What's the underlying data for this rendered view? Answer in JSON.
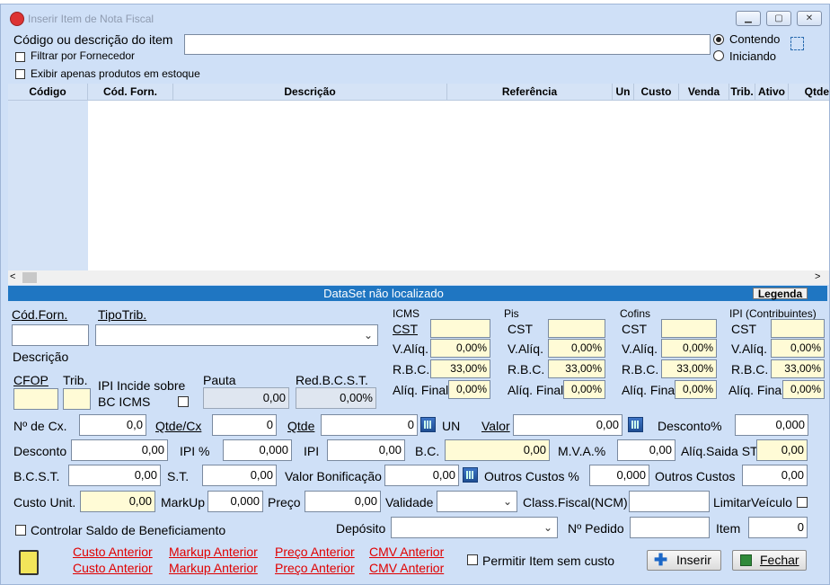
{
  "window": {
    "title": "Inserir Item de Nota Fiscal"
  },
  "search": {
    "label": "Código ou descrição do item",
    "value": "",
    "filter_fornecedor": "Filtrar por Fornecedor",
    "exibir_estoque": "Exibir apenas produtos em estoque",
    "radio_contendo": "Contendo",
    "radio_iniciando": "Iniciando",
    "selected_mode": "Contendo"
  },
  "grid": {
    "columns": [
      "Código",
      "Cód. Forn.",
      "Descrição",
      "Referência",
      "Un",
      "Custo",
      "Venda",
      "Trib.",
      "Ativo",
      "Qtde"
    ]
  },
  "status": {
    "message": "DataSet não localizado",
    "legend_button": "Legenda"
  },
  "form": {
    "cod_forn_label": "Cód.Forn.",
    "tipo_trib_label": "TipoTrib.",
    "descricao_label": "Descrição",
    "cfop_label": "CFOP",
    "trib_label": "Trib.",
    "ipi_incide_label1": "IPI Incide sobre",
    "ipi_incide_label2": "BC ICMS",
    "pauta_label": "Pauta",
    "pauta_value": "0,00",
    "red_bcst_label": "Red.B.C.S.T.",
    "red_bcst_value": "0,00%",
    "icms": {
      "title": "ICMS",
      "cst": "CST",
      "valiq_label": "V.Alíq.",
      "valiq": "0,00%",
      "rbc_label": "R.B.C.",
      "rbc": "33,00%",
      "aliq_final_label": "Alíq. Final",
      "aliq_final": "0,00%"
    },
    "pis": {
      "title": "Pis",
      "cst": "CST",
      "valiq_label": "V.Alíq.",
      "valiq": "0,00%",
      "rbc_label": "R.B.C.",
      "rbc": "33,00%",
      "aliq_final_label": "Alíq. Final",
      "aliq_final": "0,00%"
    },
    "cofins": {
      "title": "Cofins",
      "cst": "CST",
      "valiq_label": "V.Alíq.",
      "valiq": "0,00%",
      "rbc_label": "R.B.C.",
      "rbc": "33,00%",
      "aliq_final_label": "Alíq. Final",
      "aliq_final": "0,00%"
    },
    "ipi": {
      "title": "IPI (Contribuintes)",
      "cst": "CST",
      "valiq_label": "V.Alíq.",
      "valiq": "0,00%",
      "rbc_label": "R.B.C.",
      "rbc": "33,00%",
      "aliq_final_label": "Alíq. Final",
      "aliq_final": "0,00%"
    },
    "row1": {
      "n_cx_label": "Nº de Cx.",
      "n_cx": "0,0",
      "qtde_cx_label": "Qtde/Cx",
      "qtde_cx": "0",
      "qtde_label": "Qtde",
      "qtde": "0",
      "un_label": "UN",
      "valor_label": "Valor",
      "valor": "0,00",
      "desconto_pct_label": "Desconto%",
      "desconto_pct": "0,000"
    },
    "row2": {
      "desconto_label": "Desconto",
      "desconto": "0,00",
      "ipi_pct_label": "IPI %",
      "ipi_pct": "0,000",
      "ipi_label": "IPI",
      "ipi": "0,00",
      "bc_label": "B.C.",
      "bc": "0,00",
      "mva_label": "M.V.A.%",
      "mva": "0,00",
      "aliq_saida_label": "Alíq.Saida ST",
      "aliq_saida": "0,00"
    },
    "row3": {
      "bcst_label": "B.C.S.T.",
      "bcst": "0,00",
      "st_label": "S.T.",
      "st": "0,00",
      "valor_bonif_label": "Valor Bonificação",
      "valor_bonif": "0,00",
      "outros_custos_pct_label": "Outros Custos %",
      "outros_custos_pct": "0,000",
      "outros_custos_label": "Outros Custos",
      "outros_custos": "0,00"
    },
    "row4": {
      "custo_unit_label": "Custo Unit.",
      "custo_unit": "0,00",
      "markup_label": "MarkUp",
      "markup": "0,000",
      "preco_label": "Preço",
      "preco": "0,00",
      "validade_label": "Validade",
      "class_fiscal_label": "Class.Fiscal(NCM)",
      "limitar_veiculo_label": "LimitarVeículo"
    },
    "row5": {
      "controlar_saldo_label": "Controlar Saldo de Beneficiamento",
      "deposito_label": "Depósito",
      "n_pedido_label": "Nº Pedido",
      "item_label": "Item",
      "item": "0"
    }
  },
  "footer": {
    "links": [
      [
        "Custo Anterior",
        "Custo Anterior"
      ],
      [
        "Markup Anterior",
        "Markup Anterior"
      ],
      [
        "Preço Anterior",
        "Preço Anterior"
      ],
      [
        "CMV Anterior",
        "CMV Anterior"
      ]
    ],
    "permitir_sem_custo": "Permitir Item sem custo",
    "inserir_button": "Inserir",
    "fechar_button": "Fechar"
  },
  "colors": {
    "status_bar": "#1f76c2",
    "link_red": "#e00000",
    "yellow_field": "#fffbd6",
    "window_bg": "#cfe0f7"
  }
}
